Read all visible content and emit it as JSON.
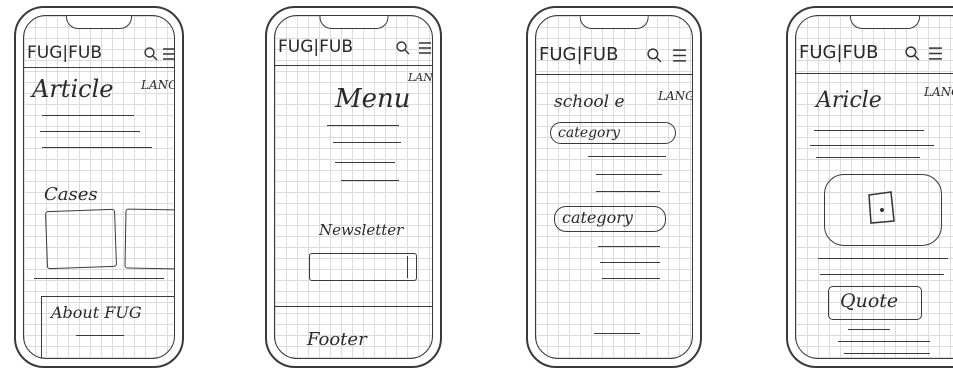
{
  "brand": "FUG|FUB",
  "lang_label": "LANG",
  "icons": [
    "search-icon",
    "menu-icon"
  ],
  "screens": [
    {
      "heading": "Article",
      "cases_label": "Cases",
      "about_label": "About FUG"
    },
    {
      "heading": "Menu",
      "newsletter_label": "Newsletter",
      "footer_label": "Footer"
    },
    {
      "heading": "school e",
      "category_labels": [
        "category",
        "category"
      ]
    },
    {
      "heading": "Aricle",
      "quote_label": "Quote"
    }
  ]
}
